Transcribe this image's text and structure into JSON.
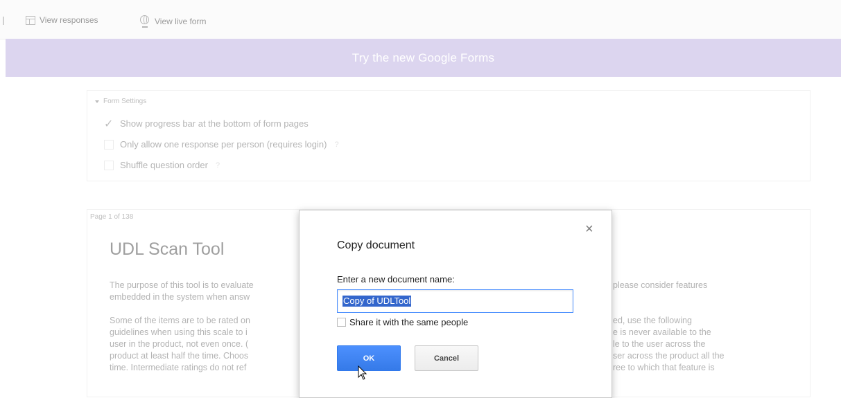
{
  "toolbar": {
    "view_responses": "View responses",
    "view_live_form": "View live form"
  },
  "banner": {
    "text": "Try the new Google Forms"
  },
  "settings": {
    "heading": "Form Settings",
    "options": [
      {
        "label": "Show progress bar at the bottom of form pages",
        "checked": true
      },
      {
        "label": "Only allow one response per person (requires login)",
        "checked": false,
        "help": "?"
      },
      {
        "label": "Shuffle question order",
        "checked": false,
        "help": "?"
      }
    ]
  },
  "page": {
    "indicator": "Page 1 of 138",
    "title": "UDL Scan Tool",
    "desc_left": [
      "The purpose of this tool is to evaluate",
      "embedded in the system when answ",
      "",
      "Some of the items are to be rated on",
      "guidelines when using this scale to i",
      "user in the product, not even once. (",
      "product at least half the time. Choos",
      "time.  Intermediate ratings do not ref"
    ],
    "desc_right": [
      "please consider features",
      "",
      "",
      "ed, use the following",
      "e is never available to the",
      "le to the user across the",
      "ser across the product all the",
      "ree to which that feature is"
    ]
  },
  "dialog": {
    "title": "Copy document",
    "close": "×",
    "label": "Enter a new document name:",
    "input_value": "Copy of UDLTool",
    "share_label": "Share it with the same people",
    "share_checked": false,
    "ok": "OK",
    "cancel": "Cancel"
  }
}
